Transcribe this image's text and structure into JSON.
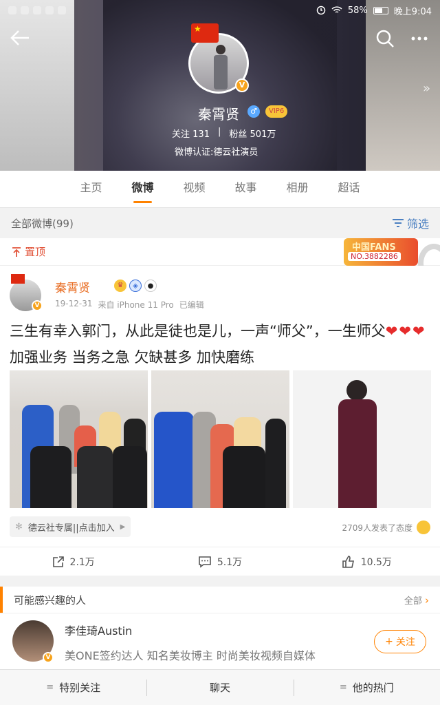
{
  "status_bar": {
    "battery": "58%",
    "time": "晚上9:04"
  },
  "profile": {
    "name": "秦霄贤",
    "vip_level": "VIP6",
    "follow_label": "关注",
    "follow_count": "131",
    "fans_label": "粉丝",
    "fans_count": "501万",
    "certification": "微博认证:德云社演员"
  },
  "tabs": [
    {
      "label": "主页"
    },
    {
      "label": "微博"
    },
    {
      "label": "视频"
    },
    {
      "label": "故事"
    },
    {
      "label": "相册"
    },
    {
      "label": "超话"
    }
  ],
  "filter_bar": {
    "label": "全部微博(99)",
    "filter_label": "筛选"
  },
  "pinned": {
    "label": "置顶"
  },
  "fans_badge": {
    "title": "中国FANS",
    "number": "NO.3882286"
  },
  "post": {
    "author": "秦霄贤",
    "date": "19-12-31",
    "source": "来自 iPhone 11 Pro",
    "edited": "已编辑",
    "text_1": "三生有幸入郭门，从此是徒也是儿，一声“师父”，一生师父",
    "hearts": "❤❤❤",
    "text_2": " 加强业务 当务之急 欠缺甚多 加快磨练",
    "group_chip": "德云社专属||点击加入",
    "reactions": "2709人发表了态度",
    "repost_count": "2.1万",
    "comment_count": "5.1万",
    "like_count": "10.5万"
  },
  "recommend": {
    "title": "可能感兴趣的人",
    "all_label": "全部",
    "user_name": "李佳琦Austin",
    "user_desc": "美ONE签约达人 知名美妆博主 时尚美妆视频自媒体",
    "follow_button": "关注"
  },
  "bottom_bar": {
    "special_follow": "特别关注",
    "chat": "聊天",
    "hot": "他的热门"
  },
  "colors": {
    "accent": "#ff8200",
    "link": "#4a7fc1",
    "name": "#e86a1e"
  }
}
